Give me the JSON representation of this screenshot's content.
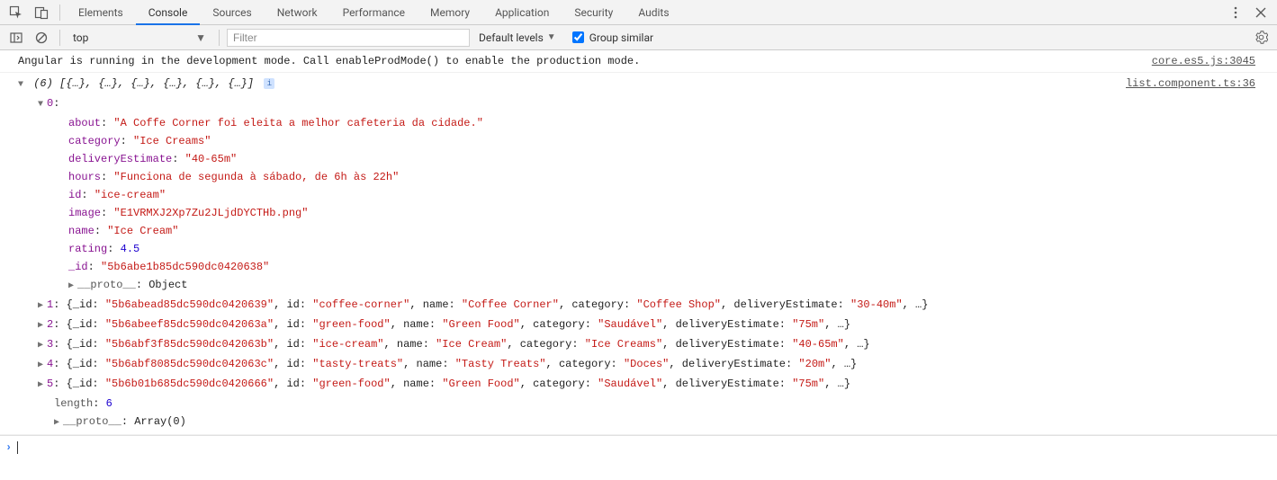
{
  "tabs": {
    "items": [
      "Elements",
      "Console",
      "Sources",
      "Network",
      "Performance",
      "Memory",
      "Application",
      "Security",
      "Audits"
    ],
    "active": 1
  },
  "toolbar": {
    "context": "top",
    "filter_placeholder": "Filter",
    "levels_label": "Default levels",
    "group_similar_label": "Group similar",
    "group_similar_checked": true
  },
  "log": {
    "message1": {
      "text": "Angular is running in the development mode. Call enableProdMode() to enable the production mode.",
      "source": "core.es5.js:3045"
    },
    "array": {
      "summary_prefix": "(6)",
      "summary_body": " [{…}, {…}, {…}, {…}, {…}, {…}]",
      "source": "list.component.ts:36",
      "index0": {
        "label": "0",
        "props": {
          "about": {
            "k": "about",
            "v": "\"A Coffe Corner foi eleita a melhor cafeteria da cidade.\""
          },
          "category": {
            "k": "category",
            "v": "\"Ice Creams\""
          },
          "deliveryEstimate": {
            "k": "deliveryEstimate",
            "v": "\"40-65m\""
          },
          "hours": {
            "k": "hours",
            "v": "\"Funciona de segunda à sábado, de 6h às 22h\""
          },
          "id": {
            "k": "id",
            "v": "\"ice-cream\""
          },
          "image": {
            "k": "image",
            "v": "\"E1VRMXJ2Xp7Zu2JLjdDYCTHb.png\""
          },
          "name": {
            "k": "name",
            "v": "\"Ice Cream\""
          },
          "rating": {
            "k": "rating",
            "v": "4.5"
          },
          "_id": {
            "k": "_id",
            "v": "\"5b6abe1b85dc590dc0420638\""
          }
        },
        "proto": {
          "k": "__proto__",
          "v": "Object"
        }
      },
      "rows": [
        {
          "idx": "1",
          "_id": "\"5b6abead85dc590dc0420639\"",
          "id": "\"coffee-corner\"",
          "name": "\"Coffee Corner\"",
          "category": "\"Coffee Shop\"",
          "deliveryEstimate": "\"30-40m\""
        },
        {
          "idx": "2",
          "_id": "\"5b6abeef85dc590dc042063a\"",
          "id": "\"green-food\"",
          "name": "\"Green Food\"",
          "category": "\"Saudável\"",
          "deliveryEstimate": "\"75m\""
        },
        {
          "idx": "3",
          "_id": "\"5b6abf3f85dc590dc042063b\"",
          "id": "\"ice-cream\"",
          "name": "\"Ice Cream\"",
          "category": "\"Ice Creams\"",
          "deliveryEstimate": "\"40-65m\""
        },
        {
          "idx": "4",
          "_id": "\"5b6abf8085dc590dc042063c\"",
          "id": "\"tasty-treats\"",
          "name": "\"Tasty Treats\"",
          "category": "\"Doces\"",
          "deliveryEstimate": "\"20m\""
        },
        {
          "idx": "5",
          "_id": "\"5b6b01b685dc590dc0420666\"",
          "id": "\"green-food\"",
          "name": "\"Green Food\"",
          "category": "\"Saudável\"",
          "deliveryEstimate": "\"75m\""
        }
      ],
      "length": {
        "k": "length",
        "v": "6"
      },
      "proto": {
        "k": "__proto__",
        "v": "Array(0)"
      }
    }
  },
  "labels": {
    "_id": "_id",
    "id": "id",
    "name": "name",
    "category": "category",
    "deliveryEstimate": "deliveryEstimate"
  }
}
